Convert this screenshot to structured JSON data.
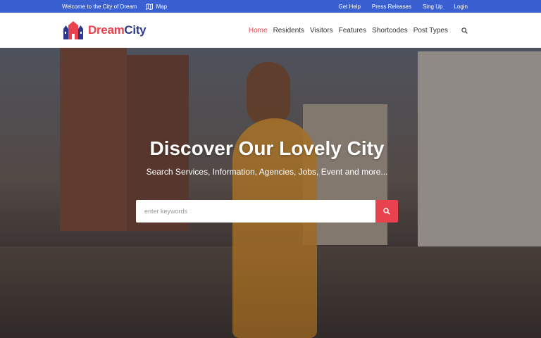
{
  "topbar": {
    "welcome": "Welcome to the City of Dream",
    "map_label": "Map",
    "links": [
      "Get Help",
      "Press Releases",
      "Sing Up",
      "Login"
    ]
  },
  "header": {
    "logo_dream": "Dream",
    "logo_city": "City",
    "nav": [
      "Home",
      "Residents",
      "Visitors",
      "Features",
      "Shortcodes",
      "Post Types"
    ],
    "active_index": 0
  },
  "hero": {
    "title": "Discover Our Lovely City",
    "subtitle": "Search Services, Information, Agencies, Jobs, Event and more...",
    "search_placeholder": "enter keywords"
  },
  "colors": {
    "topbar": "#3a5fd0",
    "accent": "#e8424f",
    "logo_blue": "#2d3a8c"
  },
  "icons": {
    "map": "map-icon",
    "search_nav": "search-icon",
    "search_button": "search-icon",
    "logo": "castle-logo-icon"
  }
}
